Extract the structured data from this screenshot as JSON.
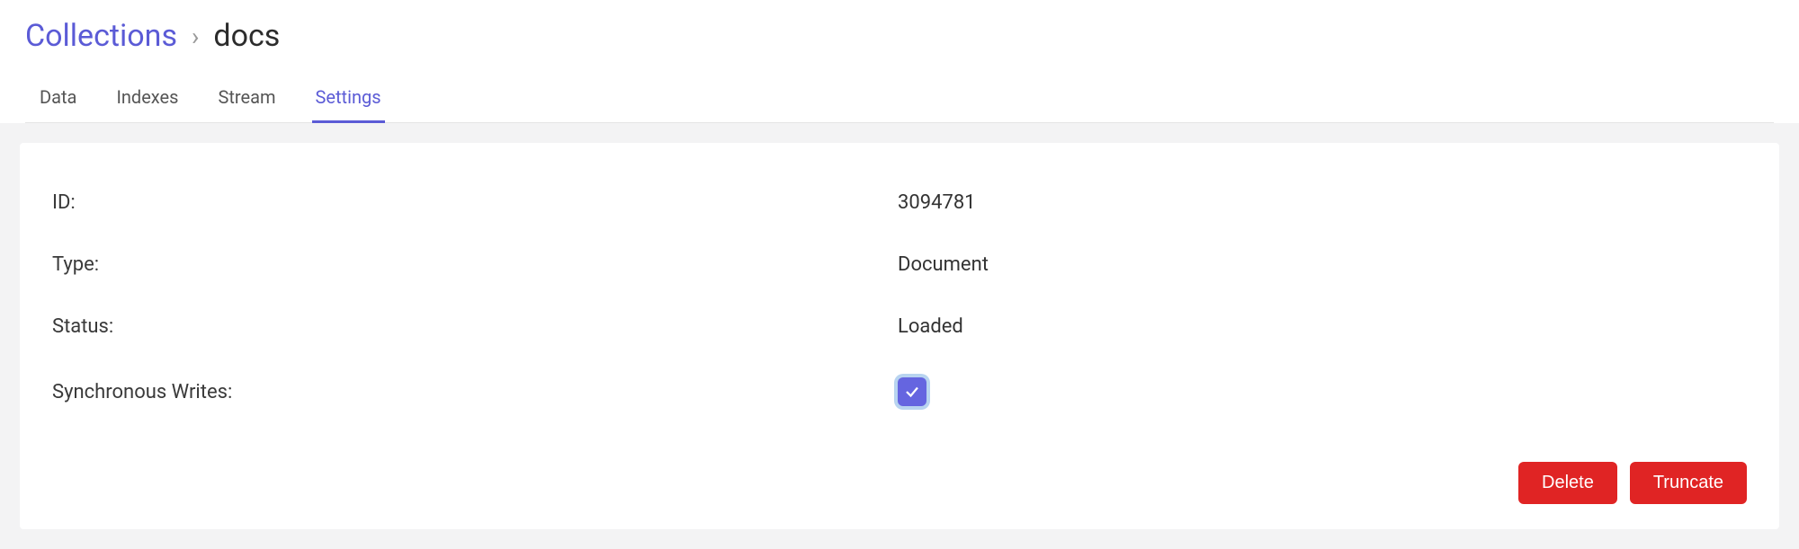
{
  "breadcrumb": {
    "parent": "Collections",
    "separator": "›",
    "current": "docs"
  },
  "tabs": [
    {
      "label": "Data",
      "active": false
    },
    {
      "label": "Indexes",
      "active": false
    },
    {
      "label": "Stream",
      "active": false
    },
    {
      "label": "Settings",
      "active": true
    }
  ],
  "settings": {
    "rows": [
      {
        "label": "ID:",
        "value": "3094781"
      },
      {
        "label": "Type:",
        "value": "Document"
      },
      {
        "label": "Status:",
        "value": "Loaded"
      }
    ],
    "syncWrites": {
      "label": "Synchronous Writes:",
      "checked": true
    }
  },
  "actions": {
    "delete": "Delete",
    "truncate": "Truncate"
  }
}
